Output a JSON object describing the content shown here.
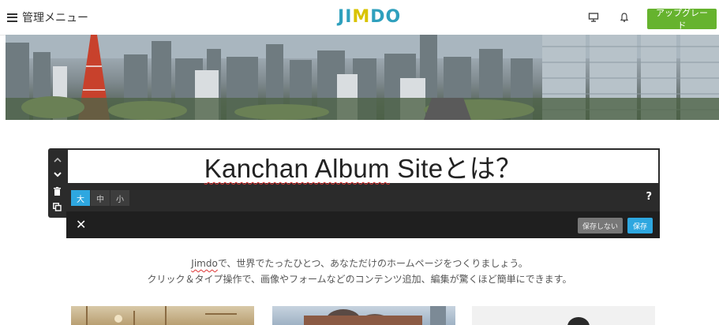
{
  "topbar": {
    "menu_label": "管理メニュー",
    "logo_text": "JIMDO",
    "logo_parts": [
      "J",
      "I",
      "M",
      "DO"
    ],
    "preview_icon": "desktop-icon",
    "notification_icon": "bell-icon",
    "upgrade_label": "アップグレード",
    "upgrade_color": "#66b32e"
  },
  "editor": {
    "title": "Kanchan Album Siteとは？",
    "title_underlined": "Kanchan Album",
    "title_rest": " Siteとは？",
    "sizes": [
      "大",
      "中",
      "小"
    ],
    "active_size": "大",
    "help_label": "?",
    "close_label": "✕",
    "nosave_label": "保存しない",
    "save_label": "保存",
    "accent_color": "#2ea7e0",
    "side_tools": [
      "chevron-up-icon",
      "chevron-down-icon",
      "trash-icon",
      "copy-icon"
    ]
  },
  "description": {
    "line1_brand": "Jimdo",
    "line1_rest": "で、世界でたったひとつ、あなただけのホームページをつくりましょう。",
    "line2": "クリック＆タイプ操作で、画像やフォームなどのコンテンツ追加、編集が驚くほど簡単にできます。"
  }
}
